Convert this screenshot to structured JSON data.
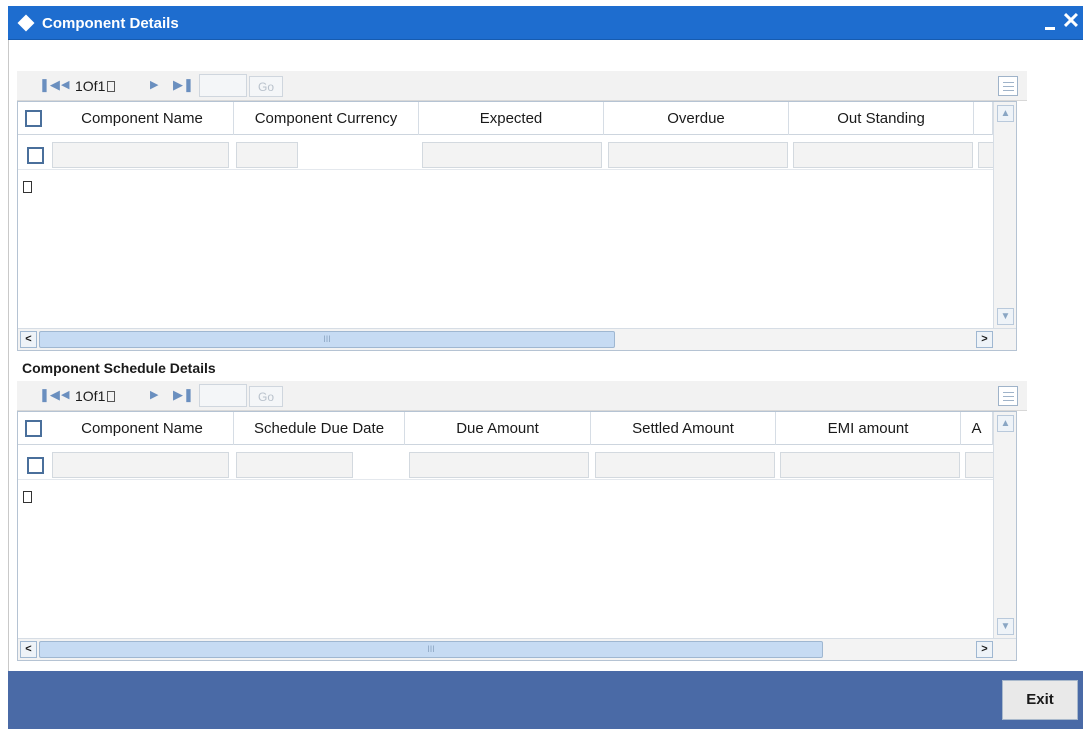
{
  "window": {
    "title": "Component Details",
    "minimize_label": "_",
    "close_label": "✕"
  },
  "grid1": {
    "pagination": {
      "page_text": "1Of1",
      "go_label": "Go"
    },
    "columns": [
      "Component Name",
      "Component Currency",
      "Expected",
      "Overdue",
      "Out Standing"
    ]
  },
  "section2_label": "Component Schedule Details",
  "grid2": {
    "pagination": {
      "page_text": "1Of1",
      "go_label": "Go"
    },
    "columns": [
      "Component Name",
      "Schedule Due Date",
      "Due Amount",
      "Settled Amount",
      "EMI amount",
      "A"
    ]
  },
  "scroll_thumb_label": "III",
  "footer": {
    "exit_label": "Exit"
  },
  "colors": {
    "titlebar": "#1e6dcf",
    "footer": "#4a6aa6"
  }
}
